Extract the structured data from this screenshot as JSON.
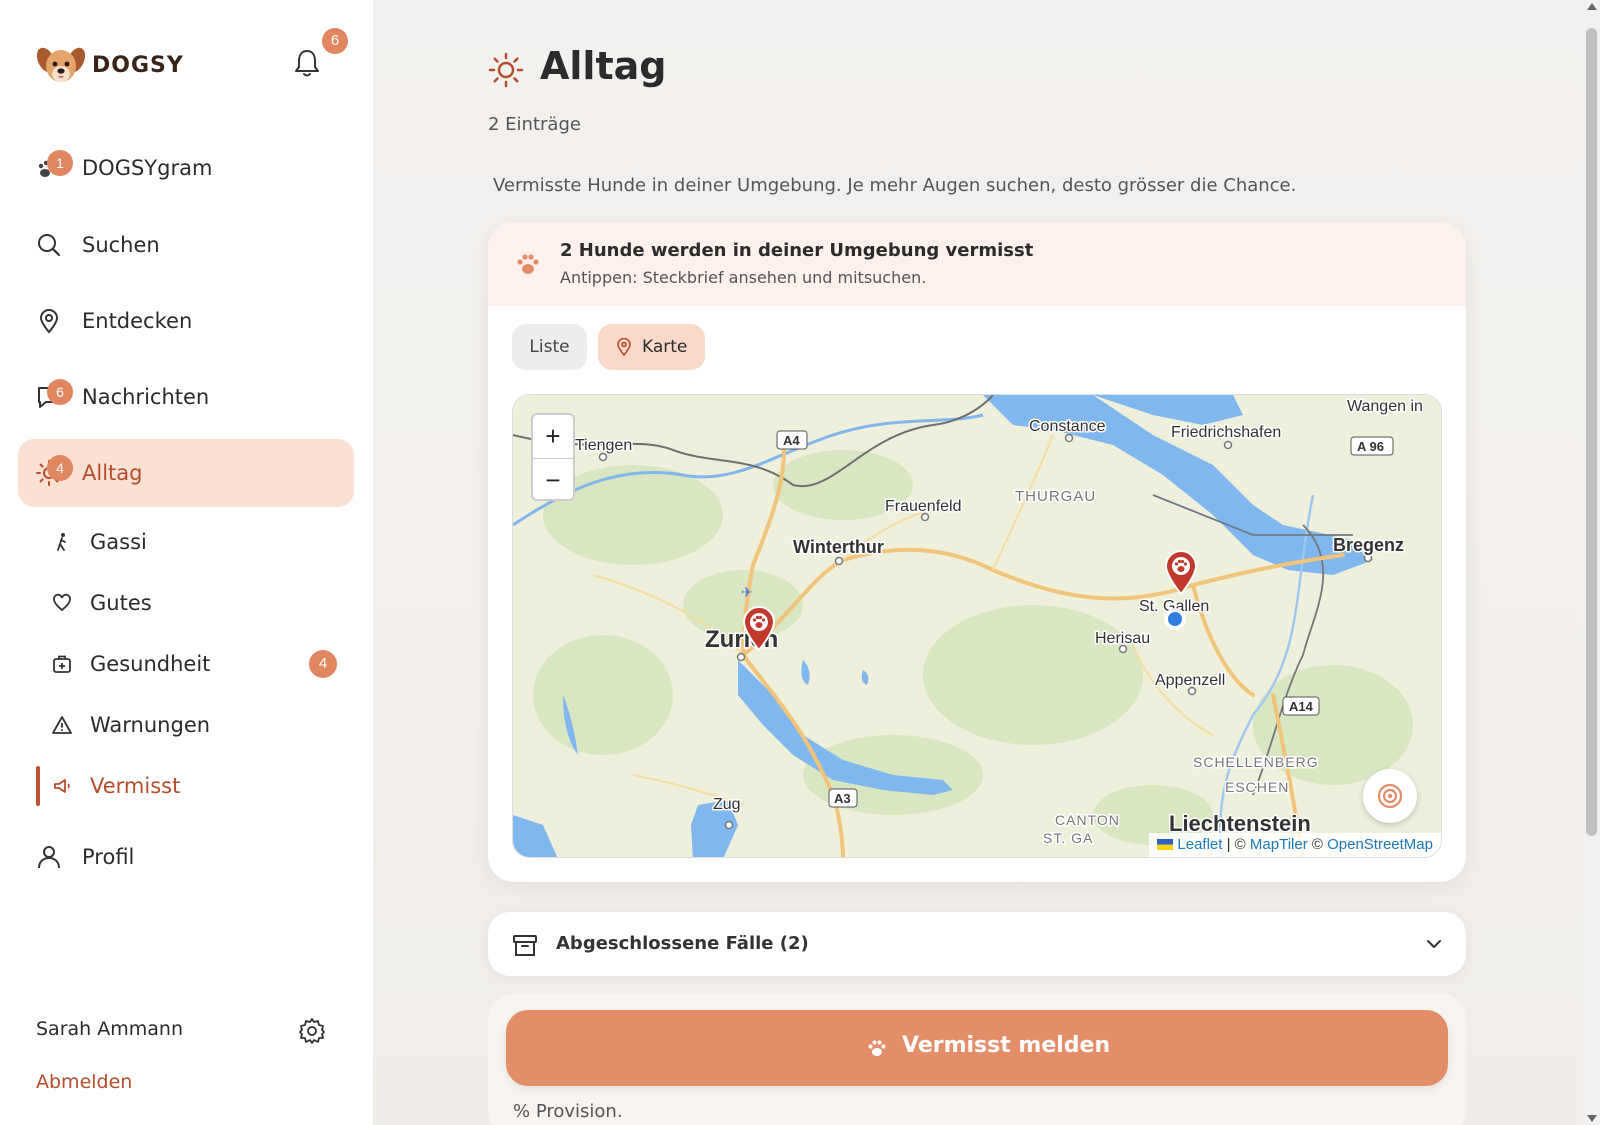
{
  "app": {
    "name": "DOGSY",
    "notifications_count": "6"
  },
  "sidebar": {
    "items": [
      {
        "label": "DOGSYgram",
        "icon": "paw-icon",
        "badge": "1"
      },
      {
        "label": "Suchen",
        "icon": "search-icon"
      },
      {
        "label": "Entdecken",
        "icon": "location-pin-icon"
      },
      {
        "label": "Nachrichten",
        "icon": "chat-icon",
        "badge": "6"
      },
      {
        "label": "Alltag",
        "icon": "sun-icon",
        "badge": "4",
        "active": true
      }
    ],
    "sub_items": [
      {
        "label": "Gassi",
        "icon": "walking-icon"
      },
      {
        "label": "Gutes",
        "icon": "heart-icon"
      },
      {
        "label": "Gesundheit",
        "icon": "medical-kit-icon",
        "badge": "4"
      },
      {
        "label": "Warnungen",
        "icon": "warning-icon"
      },
      {
        "label": "Vermisst",
        "icon": "megaphone-icon",
        "active": true
      }
    ],
    "profile": {
      "label": "Profil",
      "icon": "user-icon"
    },
    "user": {
      "name": "Sarah Ammann",
      "logout": "Abmelden"
    }
  },
  "main": {
    "title": "Alltag",
    "entries": "2 Einträge",
    "intro": "Vermisste Hunde in deiner Umgebung. Je mehr Augen suchen, desto grösser die Chance.",
    "alert": {
      "title": "2 Hunde werden in deiner Umgebung vermisst",
      "subtitle": "Antippen: Steckbrief ansehen und mitsuchen."
    },
    "tabs": {
      "list": "Liste",
      "map": "Karte",
      "selected": "Karte"
    },
    "map": {
      "zoom_in": "+",
      "zoom_out": "−",
      "labels": {
        "tiengen": "Tiengen",
        "constance": "Constance",
        "friedrichshafen": "Friedrichshafen",
        "wangen": "Wangen in",
        "frauenfeld": "Frauenfeld",
        "thurgau": "THURGAU",
        "winterthur": "Winterthur",
        "bregenz": "Bregenz",
        "zurich": "Zurich",
        "st_gallen": "St. Gallen",
        "herisau": "Herisau",
        "appenzell": "Appenzell",
        "schellenberg": "SCHELLENBERG",
        "eschen": "ESCHEN",
        "zug": "Zug",
        "canton": "CANTON",
        "st_ga": "ST. GA",
        "liechtenstein": "Liechtenstein",
        "a4": "A4",
        "a96": "A 96",
        "a14": "A14",
        "a3": "A3"
      },
      "attribution": {
        "leaflet": "Leaflet",
        "sep1": " | © ",
        "maptiler": "MapTiler",
        "sep2": " © ",
        "osm": "OpenStreetMap"
      },
      "colors": {
        "land": "#eef0dc",
        "water": "#7fb7ee",
        "road": "#f3c67a",
        "marker": "#c0392b",
        "user": "#2f7de1"
      }
    },
    "closed_cases": "Abgeschlossene Fälle (2)",
    "report_button": "Vermisst melden",
    "provision": "% Provision."
  },
  "colors": {
    "accent": "#e38e68",
    "active_bg": "#fbe1d4",
    "active_text": "#b64d2b"
  }
}
